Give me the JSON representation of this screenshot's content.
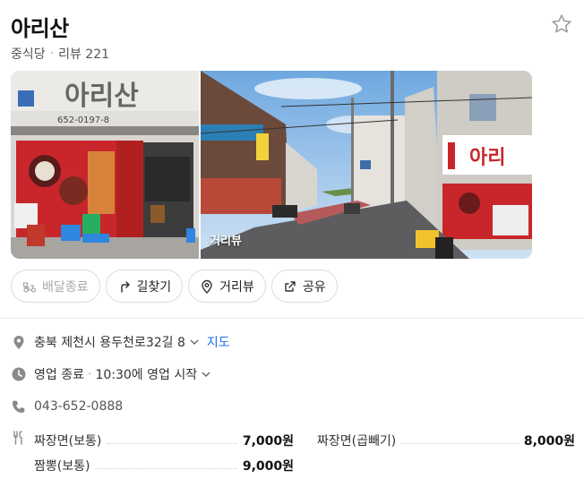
{
  "place": {
    "name": "아리산",
    "category": "중식당",
    "separator": "·",
    "reviews": "리뷰 221"
  },
  "photos": {
    "streetview_label": "거리뷰",
    "sign_text": "아리산",
    "sign_phone": "652-0197-8"
  },
  "actions": [
    {
      "label": "배달종료",
      "icon": "scooter-icon",
      "disabled": true
    },
    {
      "label": "길찾기",
      "icon": "directions-arrow-icon"
    },
    {
      "label": "거리뷰",
      "icon": "location-pin-icon"
    },
    {
      "label": "공유",
      "icon": "share-icon"
    }
  ],
  "info": {
    "address": "충북 제천시 용두천로32길 8",
    "map_link": "지도",
    "hours_status": "영업 종료",
    "hours_detail": "10:30에 영업 시작",
    "phone": "043-652-0888"
  },
  "menu": [
    {
      "name": "짜장면(보통)",
      "price": "7,000원"
    },
    {
      "name": "짜장면(곱빼기)",
      "price": "8,000원"
    },
    {
      "name": "짬뽕(보통)",
      "price": "9,000원"
    }
  ],
  "colors": {
    "link": "#1a73e8",
    "sign_red": "#c8262a"
  }
}
